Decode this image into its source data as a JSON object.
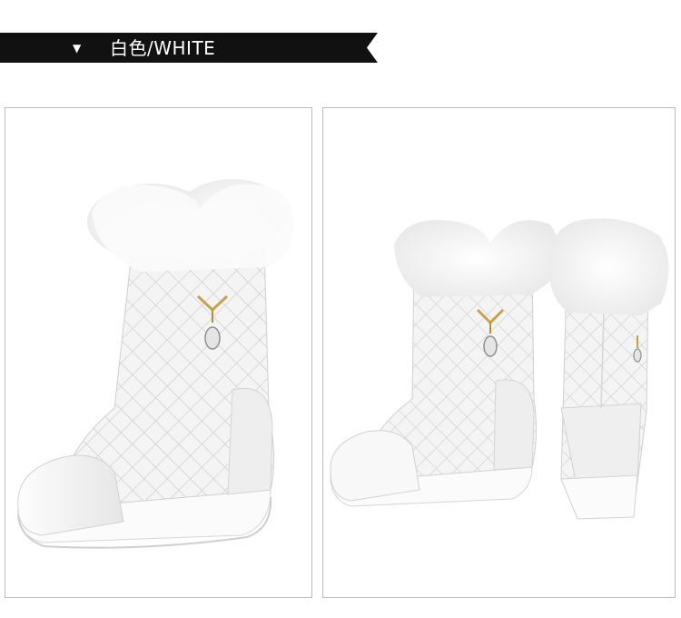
{
  "header": {
    "arrow_icon": "triangle-down-icon",
    "label": "白色/WHITE"
  },
  "colors": {
    "banner": "#111111",
    "banner_text": "#ffffff",
    "panel_border": "#bdbdbd",
    "boot": "#f2f2f2",
    "fur": "#fafafa",
    "quilt_line": "#d4d4d4"
  }
}
